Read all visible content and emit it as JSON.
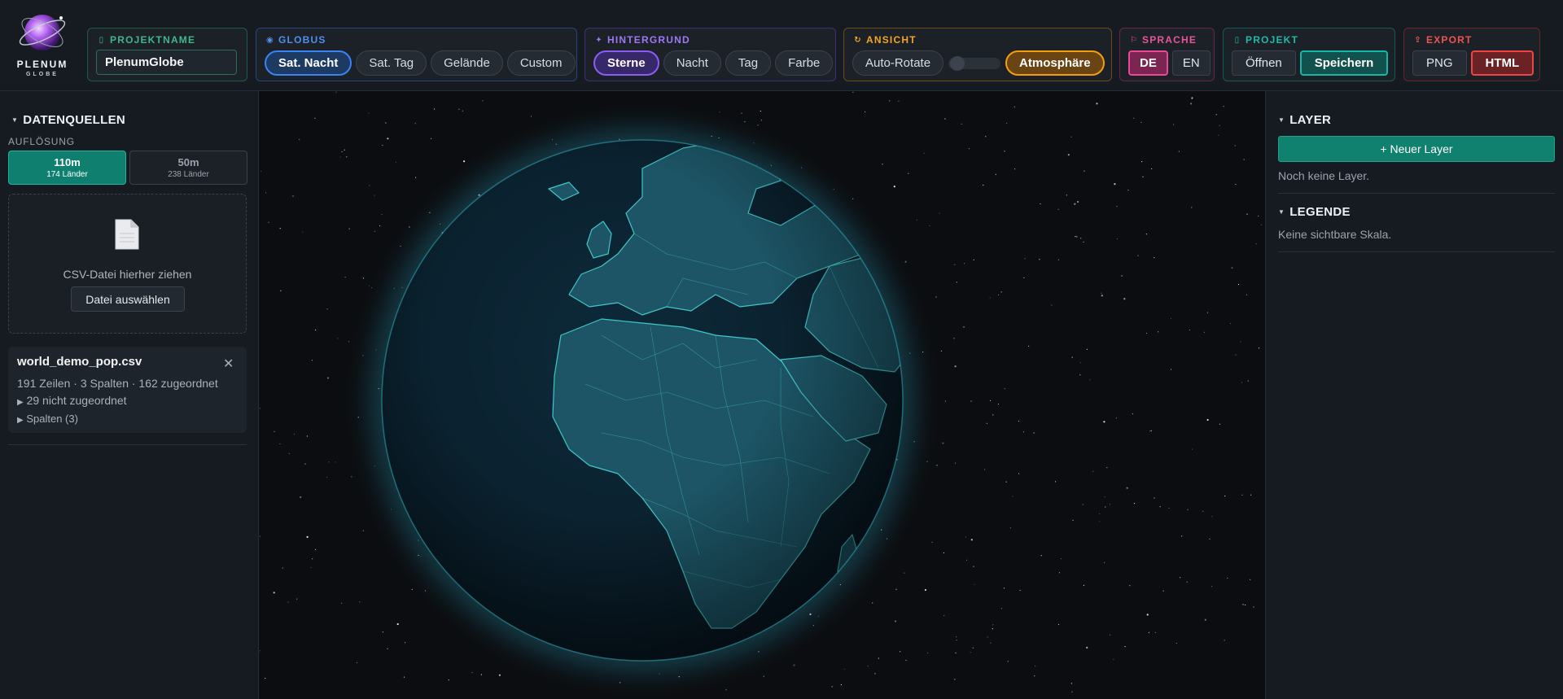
{
  "logo": {
    "name": "PLENUM",
    "sub": "GLOBE"
  },
  "projektname": {
    "label": "PROJEKTNAME",
    "value": "PlenumGlobe",
    "color": "#3fb68b"
  },
  "globus": {
    "label": "GLOBUS",
    "color": "#3b82f6",
    "options": [
      "Sat. Nacht",
      "Sat. Tag",
      "Gelände",
      "Custom"
    ],
    "selected": "Sat. Nacht"
  },
  "hintergrund": {
    "label": "HINTERGRUND",
    "color": "#8b5cf6",
    "options": [
      "Sterne",
      "Nacht",
      "Tag",
      "Farbe"
    ],
    "selected": "Sterne"
  },
  "ansicht": {
    "label": "ANSICHT",
    "color": "#f59e0b",
    "auto_rotate": "Auto-Rotate",
    "auto_rotate_on": false,
    "atmosphere": "Atmosphäre"
  },
  "sprache": {
    "label": "SPRACHE",
    "color": "#ec4899",
    "options": [
      "DE",
      "EN"
    ],
    "selected": "DE"
  },
  "projekt": {
    "label": "PROJEKT",
    "color": "#14b8a6",
    "open": "Öffnen",
    "save": "Speichern"
  },
  "export": {
    "label": "EXPORT",
    "color": "#ef4444",
    "png": "PNG",
    "html": "HTML"
  },
  "datenquellen": {
    "title": "DATENQUELLEN",
    "resolution_label": "AUFLÖSUNG",
    "resolutions": [
      {
        "name": "110m",
        "count": "174 Länder"
      },
      {
        "name": "50m",
        "count": "238 Länder"
      }
    ],
    "selected_resolution": "110m",
    "drop_text": "CSV-Datei hierher ziehen",
    "choose_button": "Datei auswählen",
    "file": {
      "name": "world_demo_pop.csv",
      "stats": "191 Zeilen · 3 Spalten · 162 zugeordnet",
      "unmatched": "29 nicht zugeordnet",
      "columns": "Spalten (3)"
    }
  },
  "layer": {
    "title": "LAYER",
    "new_button": "+ Neuer Layer",
    "empty": "Noch keine Layer."
  },
  "legende": {
    "title": "LEGENDE",
    "empty": "Keine sichtbare Skala."
  }
}
